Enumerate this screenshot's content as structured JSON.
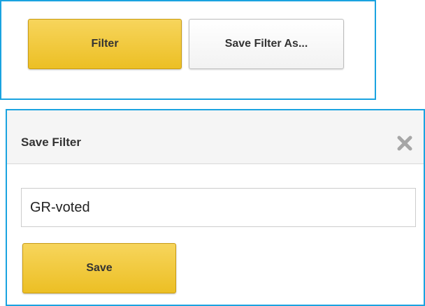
{
  "toolbar": {
    "filter_label": "Filter",
    "save_filter_as_label": "Save Filter As..."
  },
  "dialog": {
    "title": "Save Filter",
    "close_icon": "close-icon",
    "name_value": "GR-voted",
    "save_label": "Save"
  },
  "colors": {
    "highlight_border": "#1aa3e0",
    "primary_button": "#ecbf24",
    "header_bg": "#f5f5f5"
  }
}
